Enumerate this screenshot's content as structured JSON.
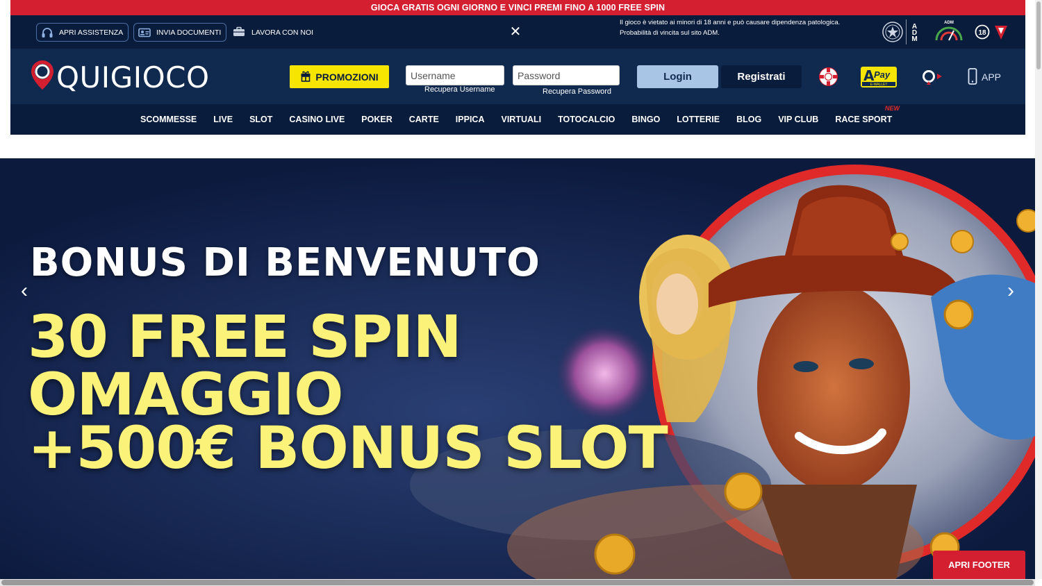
{
  "promo_strip": "GIOCA GRATIS OGNI GIORNO E VINCI PREMI FINO A 1000 FREE SPIN",
  "util": {
    "assistance": "APRI ASSISTENZA",
    "documents": "INVIA DOCUMENTI",
    "jobs": "LAVORA CON NOI",
    "warning_line1": "Il gioco è vietato ai minori di 18 anni e può causare dipendenza patologica.",
    "warning_line2": "Probabilità di vincita sul sito ADM.",
    "adm_letters": "ADM",
    "adm_small": "ADM",
    "age_badge": "18"
  },
  "header": {
    "brand": "QUIGIOCO",
    "promo_label": "PROMOZIONI",
    "username_placeholder": "Username",
    "password_placeholder": "Password",
    "recover_username": "Recupera Username",
    "recover_password": "Recupera Password",
    "login": "Login",
    "register": "Registrati",
    "apay_top": "Pay",
    "apay_sub": "E-WALLET",
    "app": "APP"
  },
  "nav": {
    "items": [
      "SCOMMESSE",
      "LIVE",
      "SLOT",
      "CASINO LIVE",
      "POKER",
      "CARTE",
      "IPPICA",
      "VIRTUALI",
      "TOTOCALCIO",
      "BINGO",
      "LOTTERIE",
      "BLOG",
      "VIP CLUB",
      "RACE SPORT"
    ],
    "new_badge": "NEW"
  },
  "hero": {
    "title": "BONUS DI BENVENUTO",
    "line1": "30 FREE SPIN",
    "line2": "OMAGGIO",
    "line3": "+500€ BONUS SLOT"
  },
  "footer_button": "APRI FOOTER",
  "colors": {
    "brand_red": "#d31f2f",
    "navy": "#0a1c3b",
    "header_blue": "#10294f",
    "promo_yellow": "#f5e500",
    "hero_yellow": "#fbf27a"
  }
}
